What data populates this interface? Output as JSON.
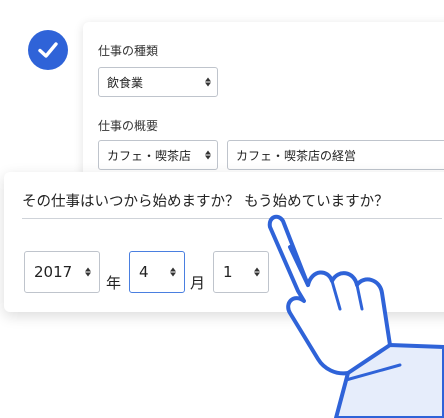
{
  "job": {
    "type_label": "仕事の種類",
    "type_value": "飲食業",
    "summary_label": "仕事の概要",
    "summary_category": "カフェ・喫茶店",
    "summary_text": "カフェ・喫茶店の経営"
  },
  "start": {
    "question": "その仕事はいつから始めますか？ もう始めていますか？",
    "year_value": "2017",
    "year_unit": "年",
    "month_value": "4",
    "month_unit": "月",
    "day_value": "1"
  },
  "colors": {
    "accent": "#2f63d8",
    "active_border": "#4a7fe0"
  },
  "icons": [
    "check-circle-icon",
    "pointing-hand-icon"
  ]
}
